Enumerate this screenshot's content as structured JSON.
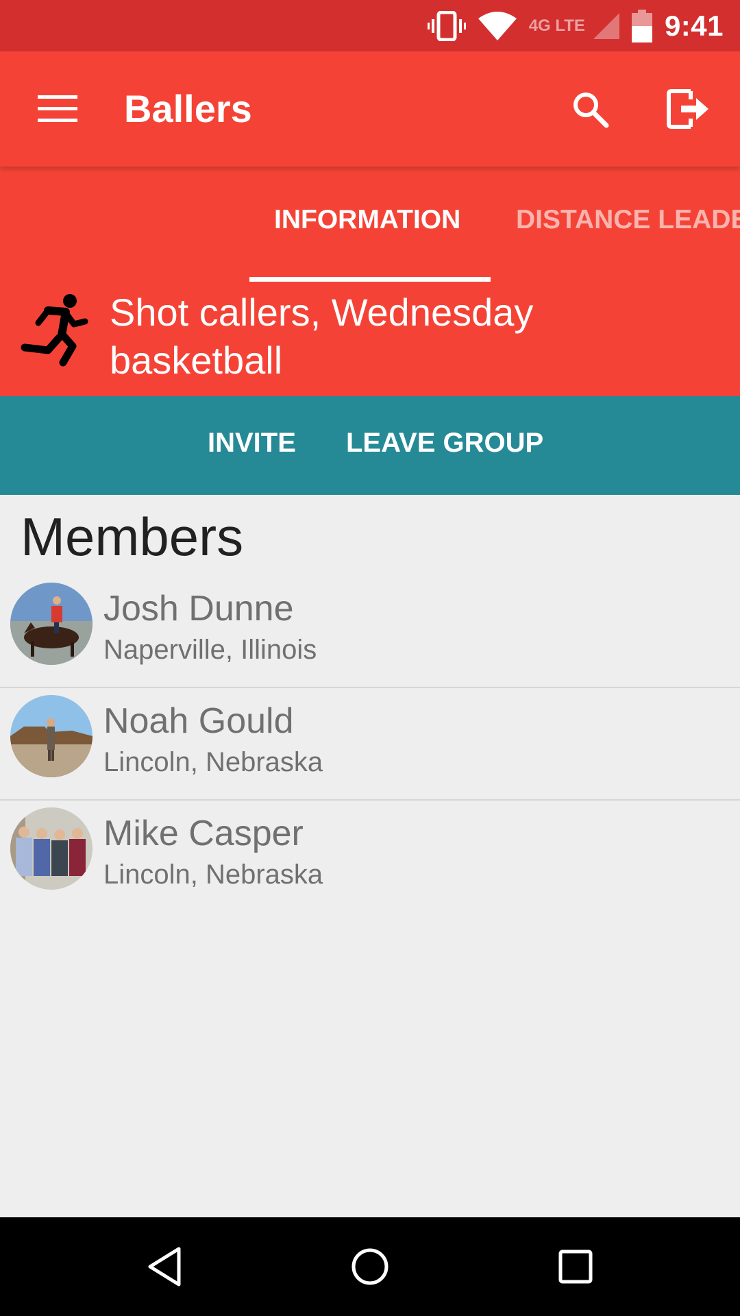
{
  "status_bar": {
    "time": "9:41",
    "network": "4G LTE",
    "icons": [
      "vibrate-icon",
      "wifi-icon",
      "cell-signal-icon",
      "battery-icon"
    ]
  },
  "app_bar": {
    "title": "Ballers",
    "menu_icon": "hamburger-menu-icon",
    "search_icon": "search-icon",
    "exit_icon": "exit-icon",
    "color": "#f44336"
  },
  "tabs": [
    {
      "label": "INFORMATION",
      "selected": true
    },
    {
      "label": "DISTANCE LEADERBOARD",
      "selected": false
    }
  ],
  "group": {
    "icon": "runner-icon",
    "name": "Shot callers, Wednesday basketball"
  },
  "actions": {
    "invite_label": "INVITE",
    "leave_label": "LEAVE GROUP",
    "color": "#258a96"
  },
  "members": {
    "title": "Members",
    "list": [
      {
        "name": "Josh Dunne",
        "location": "Naperville, Illinois"
      },
      {
        "name": "Noah Gould",
        "location": "Lincoln, Nebraska"
      },
      {
        "name": "Mike Casper",
        "location": "Lincoln, Nebraska"
      }
    ]
  },
  "nav_bar": {
    "icons": [
      "back-icon",
      "home-icon",
      "recents-icon"
    ]
  }
}
